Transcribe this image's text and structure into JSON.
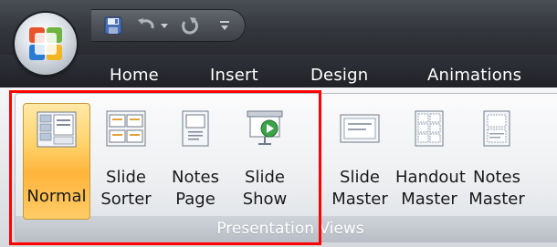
{
  "tabs": [
    {
      "label": "Home"
    },
    {
      "label": "Insert"
    },
    {
      "label": "Design"
    },
    {
      "label": "Animations"
    }
  ],
  "quick_access": [
    "save-icon",
    "undo-icon",
    "undo-dropdown-icon",
    "redo-icon",
    "customize-qat-icon"
  ],
  "group": {
    "label": "Presentation Views"
  },
  "buttons": [
    {
      "label": "Normal",
      "selected": true
    },
    {
      "label": "Slide\nSorter"
    },
    {
      "label": "Notes\nPage"
    },
    {
      "label": "Slide\nShow"
    },
    {
      "label": "Slide\nMaster"
    },
    {
      "label": "Handout\nMaster"
    },
    {
      "label": "Notes\nMaster"
    }
  ],
  "colors": {
    "highlight": "#ff0000",
    "selected": "#ffc34d",
    "chrome": "#2f3238"
  }
}
